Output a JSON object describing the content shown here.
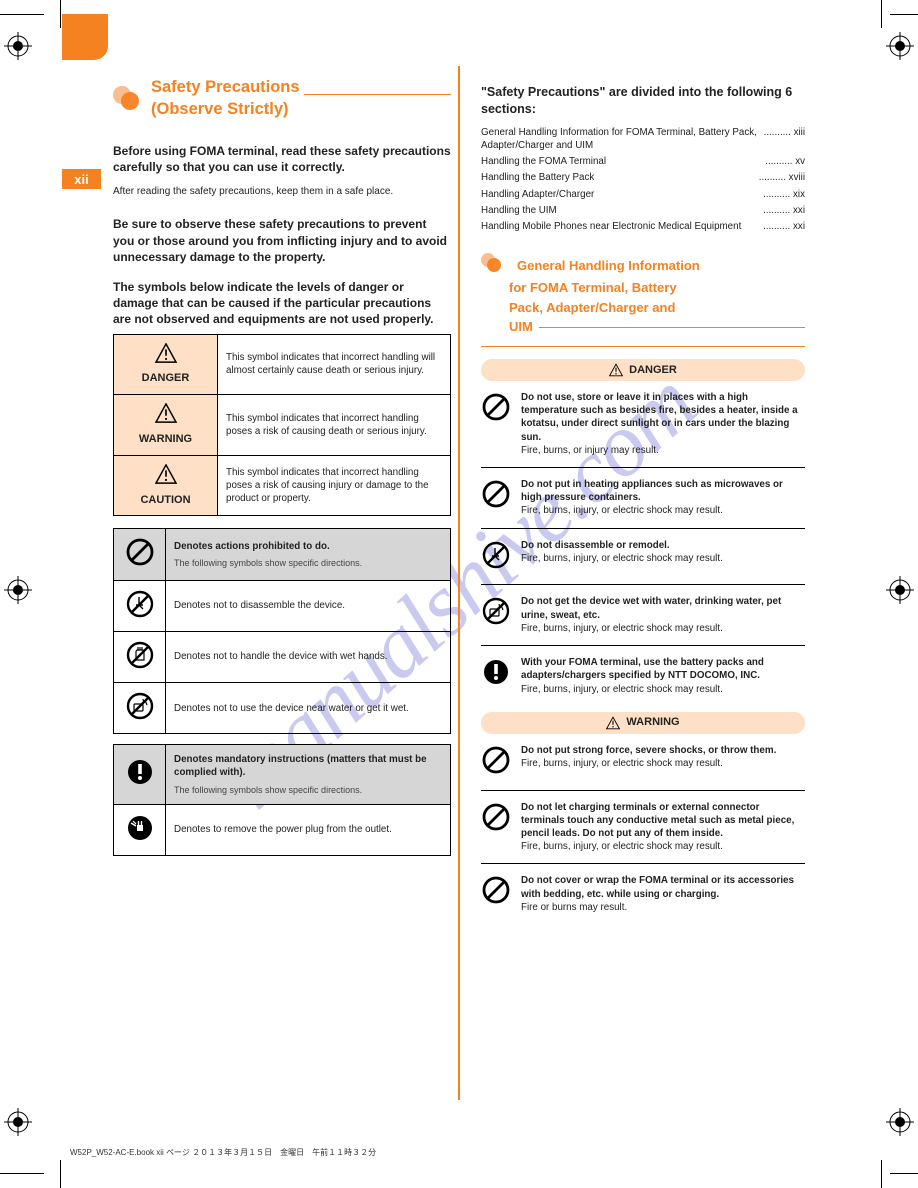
{
  "page_number": "xii",
  "watermark": "manualshive.com",
  "footer_filename": "W52P_W52-AC-E.book  xii ページ  ２０１３年３月１５日　金曜日　午前１１時３２分",
  "left": {
    "title_line1": "Safety Precautions",
    "title_line2": "(Observe Strictly)",
    "intro1": "Before using FOMA terminal, read these safety precautions carefully so that you can use it correctly.",
    "intro2": "After reading the safety precautions, keep them in a safe place.",
    "intro3": "Be sure to observe these safety precautions to prevent you or those around you from inflicting injury and to avoid unnecessary damage to the property.",
    "intro4": "The symbols below indicate the levels of danger or damage that can be caused if the particular precautions are not observed and equipments are not used properly.",
    "levels": [
      {
        "label": "DANGER",
        "desc": "This symbol indicates that incorrect handling will almost certainly cause death or serious injury."
      },
      {
        "label": "WARNING",
        "desc": "This symbol indicates that incorrect handling poses a risk of causing death or serious injury."
      },
      {
        "label": "CAUTION",
        "desc": "This symbol indicates that incorrect handling poses a risk of causing injury or damage to the product or property."
      }
    ],
    "symbols_head1": "Denotes actions prohibited to do.",
    "symbols_head1_sub": "The following symbols show specific directions.",
    "symbols1": [
      {
        "key": "disassemble",
        "text": "Denotes not to disassemble the device."
      },
      {
        "key": "wet-hands",
        "text": "Denotes not to handle the device with wet hands."
      },
      {
        "key": "water",
        "text": "Denotes not to use the device near water or get it wet."
      }
    ],
    "symbols_head2": "Denotes mandatory instructions (matters that must be complied with).",
    "symbols_head2_sub": "The following symbols show specific directions.",
    "symbols2": [
      {
        "key": "unplug",
        "text": "Denotes to remove the power plug from the outlet."
      }
    ]
  },
  "right": {
    "toc_title": "\"Safety Precautions\" are divided into the following 6 sections:",
    "toc": [
      {
        "label": "General Handling Information for FOMA Terminal, Battery Pack, Adapter/Charger and UIM",
        "page": "xiii"
      },
      {
        "label": "Handling the FOMA Terminal",
        "page": "xv"
      },
      {
        "label": "Handling the Battery Pack",
        "page": "xviii"
      },
      {
        "label": "Handling Adapter/Charger",
        "page": "xix"
      },
      {
        "label": "Handling the UIM",
        "page": "xxi"
      },
      {
        "label": "Handling Mobile Phones near Electronic Medical Equipment",
        "page": "xxi"
      }
    ],
    "section_title_line1": "General Handling Information",
    "section_title_line2": "for FOMA Terminal, Battery",
    "section_title_line3": "Pack, Adapter/Charger and",
    "section_title_line4": "UIM",
    "danger_label": "DANGER",
    "danger_items": [
      {
        "icon": "prohibit",
        "bold": "Do not use, store or leave it in places with a high temperature such as besides fire, besides a heater, inside a kotatsu, under direct sunlight or in cars under the blazing sun.",
        "body": "Fire, burns, or injury may result."
      },
      {
        "icon": "prohibit",
        "bold": "Do not put in heating appliances such as microwaves or high pressure containers.",
        "body": "Fire, burns, injury, or electric shock may result."
      },
      {
        "icon": "no-disassemble",
        "bold": "Do not disassemble or remodel.",
        "body": "Fire, burns, injury, or electric shock may result."
      },
      {
        "icon": "no-water",
        "bold": "Do not get the device wet with water, drinking water, pet urine, sweat, etc.",
        "body": "Fire, burns, injury, or electric shock may result."
      },
      {
        "icon": "mandatory",
        "bold": "With your FOMA terminal, use the battery packs and adapters/chargers specified by NTT DOCOMO, INC.",
        "body": "Fire, burns, injury, or electric shock may result."
      }
    ],
    "warning_label": "WARNING",
    "warning_items": [
      {
        "icon": "prohibit",
        "bold": "Do not put strong force, severe shocks, or throw them.",
        "body": "Fire, burns, injury, or electric shock may result."
      },
      {
        "icon": "prohibit",
        "bold": "Do not let charging terminals or external connector terminals touch any conductive metal such as metal piece, pencil leads. Do not put any of them inside.",
        "body": "Fire, burns, injury, or electric shock may result."
      },
      {
        "icon": "prohibit",
        "bold": "Do not cover or wrap the FOMA terminal or its accessories with bedding, etc. while using or charging.",
        "body": "Fire or burns may result."
      }
    ]
  }
}
